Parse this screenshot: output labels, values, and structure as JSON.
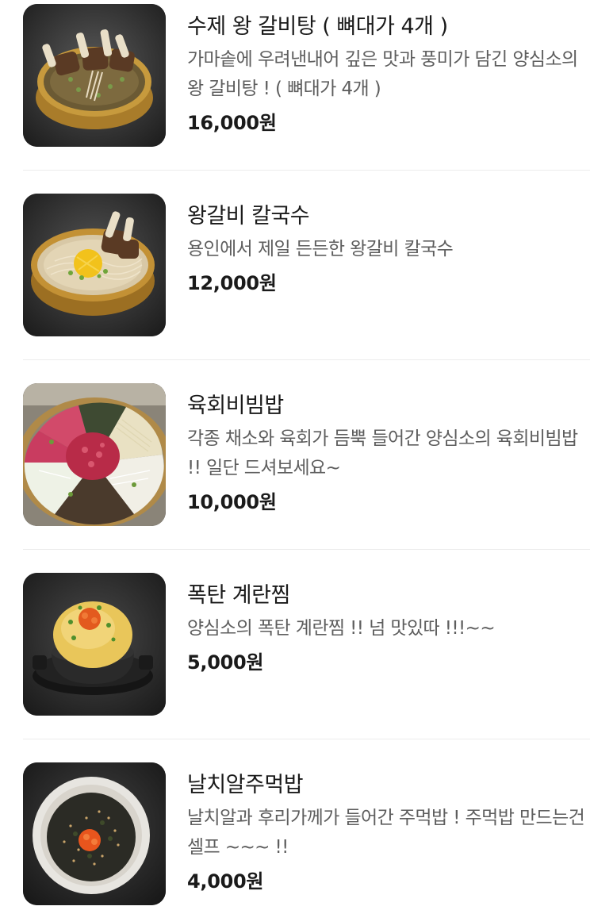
{
  "menu": {
    "items": [
      {
        "name": "수제 왕 갈비탕 ( 뼈대가 4개 )",
        "description": "가마솥에 우려낸내어 깊은 맛과 풍미가 담긴 양심소의 왕 갈비탕 ! ( 뼈대가 4개 )",
        "price": "16,000원",
        "image_icon": "galbitang-photo"
      },
      {
        "name": "왕갈비 칼국수",
        "description": "용인에서 제일 든든한 왕갈비 칼국수",
        "price": "12,000원",
        "image_icon": "kalguksu-photo"
      },
      {
        "name": "육회비빔밥",
        "description": "각종 채소와 육회가 듬뿍 들어간 양심소의 육회비빔밥 !! 일단 드셔보세요~",
        "price": "10,000원",
        "image_icon": "yukhoe-bibimbap-photo"
      },
      {
        "name": "폭탄 계란찜",
        "description": "양심소의 폭탄 계란찜 !! 넘 맛있따 !!!~~",
        "price": "5,000원",
        "image_icon": "steamed-egg-photo"
      },
      {
        "name": "날치알주먹밥",
        "description": "날치알과 후리가께가 들어간 주먹밥 ! 주먹밥 만드는건 셀프 ~~~ !!",
        "price": "4,000원",
        "image_icon": "rice-ball-photo"
      }
    ]
  },
  "colors": {
    "name": "#1a1a1a",
    "description": "#5e5e5e",
    "price": "#1a1a1a",
    "divider": "#ececec"
  }
}
